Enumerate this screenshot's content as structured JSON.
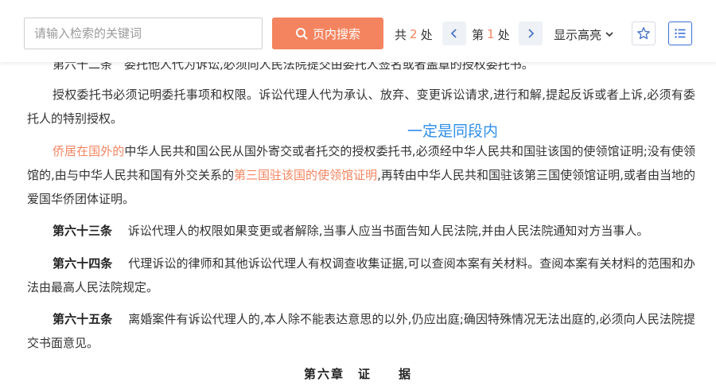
{
  "toolbar": {
    "search_placeholder": "请输入检索的关键词",
    "search_button_label": "页内搜索",
    "count_prefix": "共",
    "count_value": "2",
    "count_suffix": "处",
    "page_prefix": "第",
    "page_value": "1",
    "page_suffix": "处",
    "highlight_label": "显示高亮",
    "icons": {
      "search": "search-icon",
      "prev": "chevron-left-icon",
      "next": "chevron-right-icon",
      "dropdown": "chevron-down-icon",
      "star": "star-icon",
      "list": "list-icon"
    }
  },
  "content": {
    "cut_line": "第六十二条　委托他人代为诉讼,必须向人民法院提交由委托人签名或者盖章的授权委托书。",
    "para1": "授权委托书必须记明委托事项和权限。诉讼代理人代为承认、放弃、变更诉讼请求,进行和解,提起反诉或者上诉,必须有委托人的特别授权。",
    "para2": {
      "hl1": "侨居在国外的",
      "text1": "中华人民共和国公民从国外寄交或者托交的授权委托书,必须经中华人民共和国驻该国的使领馆证明;没有使领馆的,由与中华人民共和国有外交关系的",
      "hl2": "第三国驻该国的使领馆证明",
      "text2": ",再转由中华人民共和国驻该第三国使领馆证明,或者由当地的爱国华侨团体证明。"
    },
    "annotation": "一定是同段内",
    "art63_title": "第六十三条",
    "art63_text": "诉讼代理人的权限如果变更或者解除,当事人应当书面告知人民法院,并由人民法院通知对方当事人。",
    "art64_title": "第六十四条",
    "art64_text": "代理诉讼的律师和其他诉讼代理人有权调查收集证据,可以查阅本案有关材料。查阅本案有关材料的范围和办法由最高人民法院规定。",
    "art65_title": "第六十五条",
    "art65_text": "离婚案件有诉讼代理人的,本人除不能表达意思的以外,仍应出庭;确因特殊情况无法出庭的,必须向人民法院提交书面意见。",
    "chapter_title": "第六章　证　　据"
  },
  "colors": {
    "accent": "#f4845f",
    "annotation": "#2f8ee8",
    "nav_bg": "#eef1f6",
    "list_border": "#3a6fd8"
  }
}
